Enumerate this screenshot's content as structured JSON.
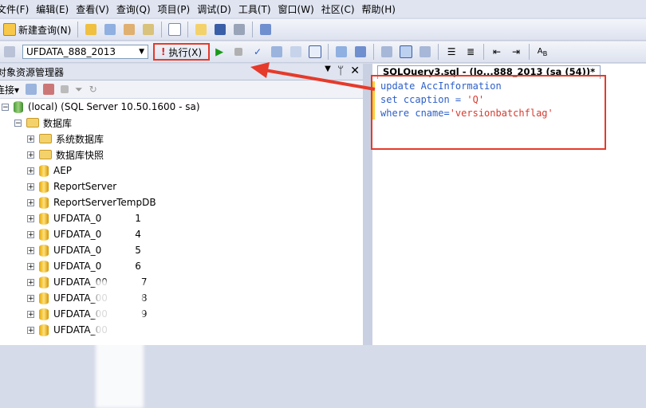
{
  "menu": [
    "文件(F)",
    "编辑(E)",
    "查看(V)",
    "查询(Q)",
    "项目(P)",
    "调试(D)",
    "工具(T)",
    "窗口(W)",
    "社区(C)",
    "帮助(H)"
  ],
  "toolbar": {
    "new_query_label": "新建查询(N)",
    "database_selected": "UFDATA_888_2013",
    "execute_label": "执行(X)"
  },
  "object_explorer": {
    "title": "对象资源管理器",
    "connect_label": "连接",
    "server": "(local) (SQL Server 10.50.1600 - sa)",
    "databases_folder": "数据库",
    "items": [
      {
        "type": "folder",
        "label": "系统数据库"
      },
      {
        "type": "folder",
        "label": "数据库快照"
      },
      {
        "type": "db",
        "label": "AEP"
      },
      {
        "type": "db",
        "label": "ReportServer"
      },
      {
        "type": "db",
        "label": "ReportServerTempDB"
      },
      {
        "type": "db",
        "label": "UFDATA_0",
        "suffix": "1"
      },
      {
        "type": "db",
        "label": "UFDATA_0",
        "suffix": "4"
      },
      {
        "type": "db",
        "label": "UFDATA_0",
        "suffix": "5"
      },
      {
        "type": "db",
        "label": "UFDATA_0",
        "suffix": "6"
      },
      {
        "type": "db",
        "label": "UFDATA_00",
        "suffix": "7"
      },
      {
        "type": "db",
        "label": "UFDATA_00",
        "suffix": "8"
      },
      {
        "type": "db",
        "label": "UFDATA_00",
        "suffix": "9"
      },
      {
        "type": "db",
        "label": "UFDATA_00",
        "suffix": ""
      }
    ]
  },
  "editor": {
    "tab_label": "SQLQuery3.sql - (lo...888_2013 (sa (54))*",
    "lines": [
      {
        "kw": "update",
        "rest": " AccInformation"
      },
      {
        "kw": "set",
        "rest": " ccaption = ",
        "str": "'Q'"
      },
      {
        "kw": "where",
        "rest": " cname=",
        "str": "'versionbatchflag'"
      }
    ]
  },
  "colors": {
    "highlight_red": "#e63a2a",
    "keyword_blue": "#2c5fc9",
    "string_red": "#d63a2f"
  }
}
